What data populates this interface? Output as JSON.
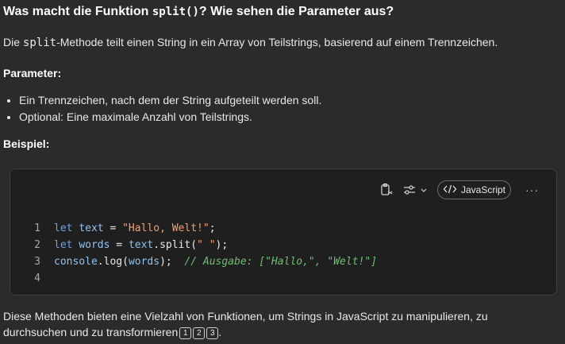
{
  "heading": {
    "before": "Was macht die Funktion ",
    "code": "split()",
    "after": "? Wie sehen die Parameter aus?"
  },
  "intro": {
    "before": "Die ",
    "code": "split",
    "after": "-Methode teilt einen String in ein Array von Teilstrings, basierend auf einem Trennzeichen."
  },
  "params_label": "Parameter:",
  "params": [
    "Ein Trennzeichen, nach dem der String aufgeteilt werden soll.",
    "Optional: Eine maximale Anzahl von Teilstrings."
  ],
  "example_label": "Beispiel:",
  "codeblock": {
    "language": "JavaScript",
    "more": "···",
    "line_numbers": [
      "1",
      "2",
      "3",
      "4"
    ],
    "l1": {
      "kw": "let",
      "var": "text",
      "eq": " = ",
      "str": "\"Hallo, Welt!\"",
      "end": ";"
    },
    "l2": {
      "kw": "let",
      "var": "words",
      "eq": " = ",
      "obj": "text",
      "call": ".split(",
      "str": "\" \"",
      "end": ");"
    },
    "l3": {
      "obj": "console",
      "call": ".log(",
      "arg": "words",
      "end": ");",
      "comment": "// Ausgabe: [\"Hallo,\", \"Welt!\"]"
    }
  },
  "outro": {
    "line1": "Diese Methoden bieten eine Vielzahl von Funktionen, um Strings in JavaScript zu manipulieren, zu",
    "line2": "durchsuchen und zu transformieren",
    "citations": [
      "1",
      "2",
      "3"
    ],
    "end": "."
  }
}
